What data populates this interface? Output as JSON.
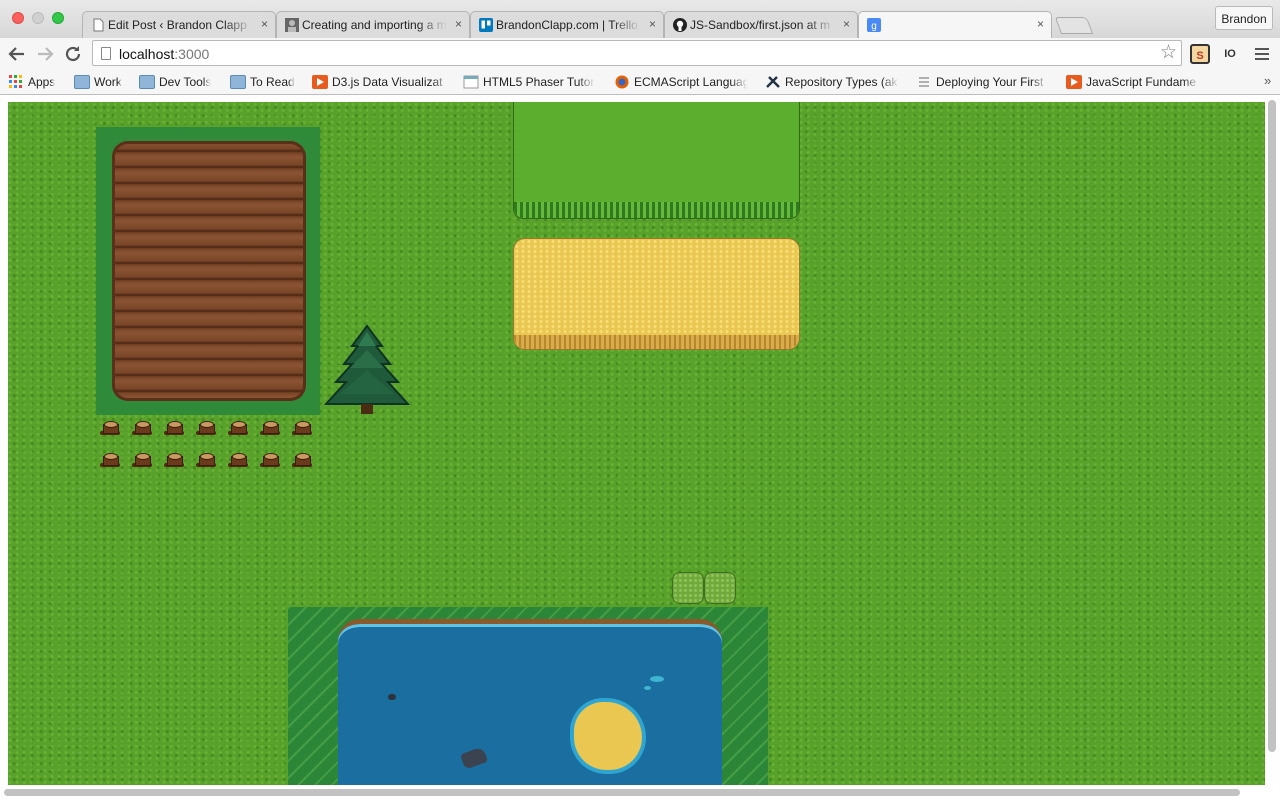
{
  "browser": {
    "tabs": [
      {
        "label": "Edit Post ‹ Brandon Clapp",
        "icon": "document-icon",
        "active": false
      },
      {
        "label": "Creating and importing a m",
        "icon": "avatar-icon",
        "active": false
      },
      {
        "label": "BrandonClapp.com | Trello",
        "icon": "trello-icon",
        "active": false
      },
      {
        "label": "JS-Sandbox/first.json at m",
        "icon": "github-icon",
        "active": false
      },
      {
        "label": "",
        "icon": "google-icon",
        "active": true
      }
    ],
    "tab_close_glyph": "×",
    "profile_name": "Brandon",
    "url_host": "localhost",
    "url_port": ":3000",
    "extensions": [
      {
        "name": "s-extension-icon",
        "text": "S",
        "color": "#c0392b"
      },
      {
        "name": "io-extension-icon",
        "text": "IO",
        "color": "#3a3a3a"
      }
    ],
    "bookmarks": [
      {
        "label": "Apps",
        "icon": "apps-grid-icon"
      },
      {
        "label": "Work",
        "icon": "folder-icon"
      },
      {
        "label": "Dev Tools",
        "icon": "folder-icon"
      },
      {
        "label": "To Read",
        "icon": "folder-icon"
      },
      {
        "label": "D3.js Data Visualizat",
        "icon": "play-icon"
      },
      {
        "label": "HTML5 Phaser Tutor",
        "icon": "page-icon"
      },
      {
        "label": "ECMAScript Languag",
        "icon": "firefox-icon"
      },
      {
        "label": "Repository Types (ak",
        "icon": "tools-icon"
      },
      {
        "label": "Deploying Your First",
        "icon": "list-icon"
      },
      {
        "label": "JavaScript Fundame",
        "icon": "play-icon"
      }
    ],
    "bookmarks_overflow": "»"
  },
  "game": {
    "background_color": "#58a12a",
    "objects": [
      "farm-plot",
      "tree-stumps",
      "pine-tree",
      "tall-grass-patch",
      "wheat-field",
      "bushes",
      "pond",
      "sand-island",
      "rocks"
    ]
  }
}
